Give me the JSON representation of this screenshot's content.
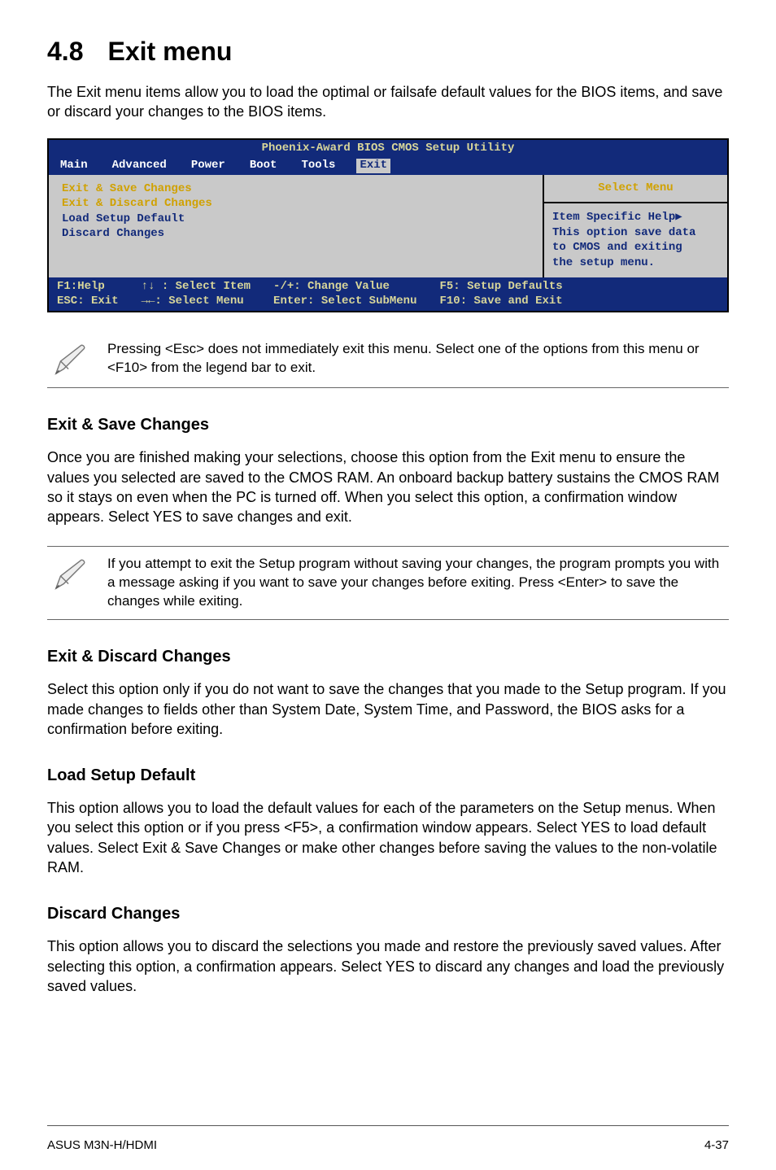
{
  "heading": {
    "number": "4.8",
    "text": "Exit menu"
  },
  "intro": "The Exit menu items allow you to load the optimal or failsafe default values for the BIOS items, and save or discard your changes to the BIOS items.",
  "bios": {
    "title": "Phoenix-Award BIOS CMOS Setup Utility",
    "tabs": [
      "Main",
      "Advanced",
      "Power",
      "Boot",
      "Tools",
      "Exit"
    ],
    "active_tab": "Exit",
    "left_items": [
      {
        "label": "Exit & Save Changes",
        "selected": true
      },
      {
        "label": "Exit & Discard Changes",
        "selected": true
      },
      {
        "label": "Load Setup Default",
        "selected": false
      },
      {
        "label": "Discard Changes",
        "selected": false
      }
    ],
    "right_title": "Select Menu",
    "right_lines": [
      "Item Specific Help▶",
      "",
      "This option save data",
      "to CMOS and exiting",
      "the setup menu."
    ],
    "footer": {
      "col1": "F1:Help\nESC: Exit",
      "col2": "↑↓ : Select Item\n→←: Select Menu",
      "col3": "-/+: Change Value\nEnter: Select SubMenu",
      "col4": "F5: Setup Defaults\nF10: Save and Exit"
    }
  },
  "note1": "Pressing <Esc> does not immediately exit this menu. Select one of the options from this menu or <F10> from the legend bar to exit.",
  "sections": {
    "s1": {
      "head": "Exit & Save Changes",
      "body": "Once you are finished making your selections, choose this option from the Exit menu to ensure the values you selected are saved to the CMOS RAM. An onboard backup battery sustains the CMOS RAM so it stays on even when the PC is turned off. When you select this option, a confirmation window appears. Select YES to save changes and exit."
    },
    "note2": "If you attempt to exit the Setup program without saving your changes, the program prompts you with a message asking if you want to save your changes before exiting. Press <Enter> to save the changes while exiting.",
    "s2": {
      "head": "Exit & Discard Changes",
      "body": "Select this option only if you do not want to save the changes that you made to the Setup program. If you made changes to fields other than System Date, System Time, and Password, the BIOS asks for a confirmation before exiting."
    },
    "s3": {
      "head": "Load Setup Default",
      "body": "This option allows you to load the default values for each of the parameters on the Setup menus. When you select this option or if you press <F5>, a confirmation window appears. Select YES to load default values. Select Exit & Save Changes or make other changes before saving the values to the non-volatile RAM."
    },
    "s4": {
      "head": "Discard Changes",
      "body": "This option allows you to discard the selections you made and restore the previously saved values. After selecting this option, a confirmation appears. Select YES to discard any changes and load the previously saved values."
    }
  },
  "footer": {
    "left": "ASUS M3N-H/HDMI",
    "right": "4-37"
  }
}
